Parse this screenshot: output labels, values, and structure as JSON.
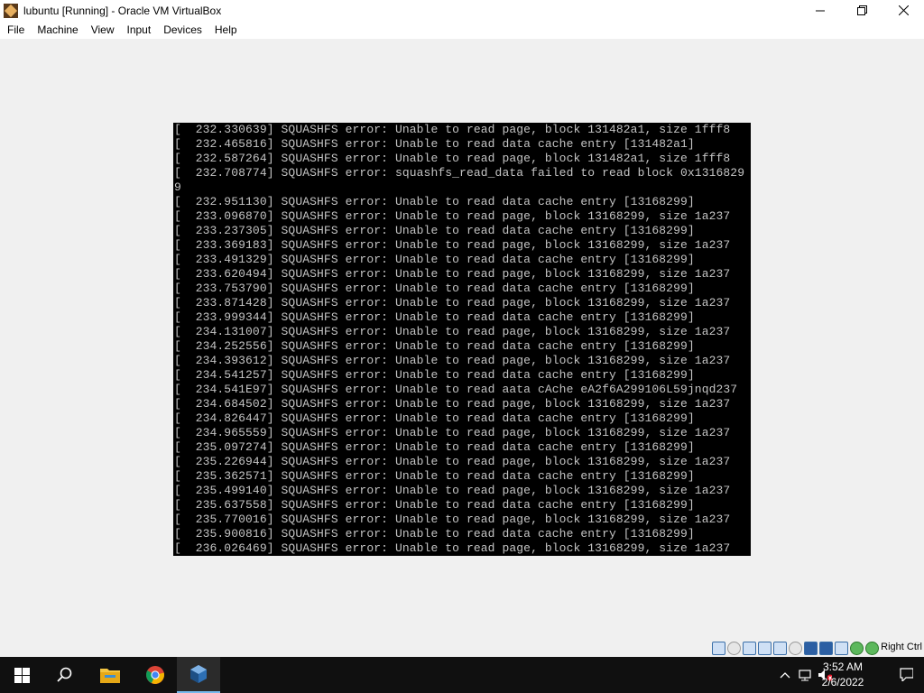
{
  "window": {
    "title": "lubuntu [Running] - Oracle VM VirtualBox",
    "minimize": "–",
    "maximize": "❐",
    "close": "✕"
  },
  "menu": {
    "items": [
      "File",
      "Machine",
      "View",
      "Input",
      "Devices",
      "Help"
    ]
  },
  "console": {
    "lines": [
      "[  232.330639] SQUASHFS error: Unable to read page, block 131482a1, size 1fff8",
      "[  232.465816] SQUASHFS error: Unable to read data cache entry [131482a1]",
      "[  232.587264] SQUASHFS error: Unable to read page, block 131482a1, size 1fff8",
      "[  232.708774] SQUASHFS error: squashfs_read_data failed to read block 0x1316829",
      "9",
      "[  232.951130] SQUASHFS error: Unable to read data cache entry [13168299]",
      "[  233.096870] SQUASHFS error: Unable to read page, block 13168299, size 1a237",
      "[  233.237305] SQUASHFS error: Unable to read data cache entry [13168299]",
      "[  233.369183] SQUASHFS error: Unable to read page, block 13168299, size 1a237",
      "[  233.491329] SQUASHFS error: Unable to read data cache entry [13168299]",
      "[  233.620494] SQUASHFS error: Unable to read page, block 13168299, size 1a237",
      "[  233.753790] SQUASHFS error: Unable to read data cache entry [13168299]",
      "[  233.871428] SQUASHFS error: Unable to read page, block 13168299, size 1a237",
      "[  233.999344] SQUASHFS error: Unable to read data cache entry [13168299]",
      "[  234.131007] SQUASHFS error: Unable to read page, block 13168299, size 1a237",
      "[  234.252556] SQUASHFS error: Unable to read data cache entry [13168299]",
      "[  234.393612] SQUASHFS error: Unable to read page, block 13168299, size 1a237",
      "[  234.541257] SQUASHFS error: Unable to read data cache entry [13168299]",
      "[  234.541E97] SQUASHFS error: Unable to read aata cAche eA2f6A299106L59jnqd237",
      "[  234.684502] SQUASHFS error: Unable to read page, block 13168299, size 1a237",
      "[  234.826447] SQUASHFS error: Unable to read data cache entry [13168299]",
      "[  234.965559] SQUASHFS error: Unable to read page, block 13168299, size 1a237",
      "[  235.097274] SQUASHFS error: Unable to read data cache entry [13168299]",
      "[  235.226944] SQUASHFS error: Unable to read page, block 13168299, size 1a237",
      "[  235.362571] SQUASHFS error: Unable to read data cache entry [13168299]",
      "[  235.499140] SQUASHFS error: Unable to read page, block 13168299, size 1a237",
      "[  235.637558] SQUASHFS error: Unable to read data cache entry [13168299]",
      "[  235.770016] SQUASHFS error: Unable to read page, block 13168299, size 1a237",
      "[  235.900816] SQUASHFS error: Unable to read data cache entry [13168299]",
      "[  236.026469] SQUASHFS error: Unable to read page, block 13168299, size 1a237"
    ]
  },
  "status_bar": {
    "host_key": "Right Ctrl",
    "icons": [
      "hard-disk-icon",
      "optical-drive-icon",
      "audio-icon",
      "network-icon",
      "usb-icon",
      "shared-folders-icon",
      "display-icon",
      "video-capture-icon",
      "cpu-icon",
      "mouse-integration-icon",
      "keyboard-icon"
    ]
  },
  "taskbar": {
    "apps": [
      "start-icon",
      "search-icon",
      "file-explorer-icon",
      "chrome-icon",
      "virtualbox-icon"
    ],
    "time": "3:52 AM",
    "date": "2/6/2022"
  },
  "colors": {
    "console_bg": "#000000",
    "console_text": "#c4c4c4",
    "taskbar_bg": "#101010",
    "window_bg": "#f0f0f0"
  }
}
